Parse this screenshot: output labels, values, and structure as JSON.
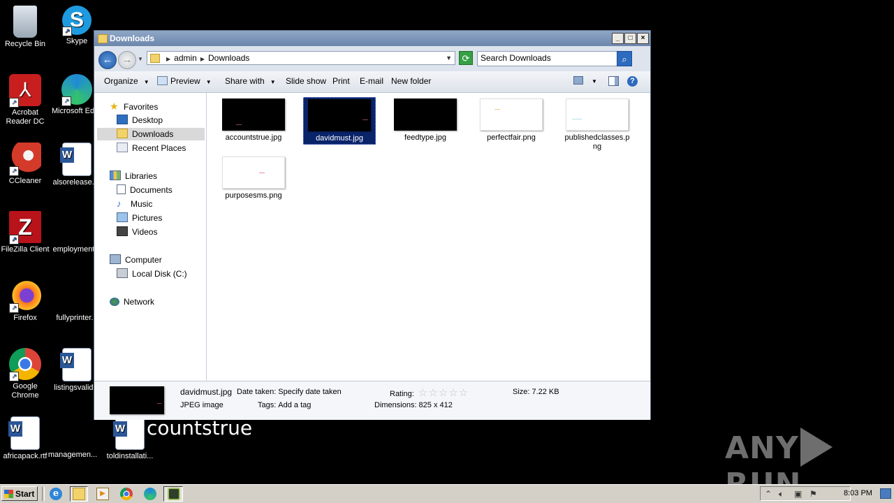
{
  "desktop": {
    "icons": [
      {
        "label": "Recycle Bin"
      },
      {
        "label": "Skype"
      },
      {
        "label": "Acrobat Reader DC"
      },
      {
        "label": "Microsoft Edge"
      },
      {
        "label": "CCleaner"
      },
      {
        "label": "alsorelease.rtf"
      },
      {
        "label": "FileZilla Client"
      },
      {
        "label": "employment..."
      },
      {
        "label": "Firefox"
      },
      {
        "label": "fullyprinter..."
      },
      {
        "label": "Google Chrome"
      },
      {
        "label": "listingsvalid..."
      },
      {
        "label": "africapack.rtf"
      },
      {
        "label": "managemen..."
      },
      {
        "label": "toldinstallati..."
      }
    ],
    "drag_text": "countstrue",
    "watermark": "ANY RUN"
  },
  "window": {
    "title": "Downloads",
    "controls": {
      "minimize": "_",
      "maximize": "□",
      "close": "×"
    },
    "address": {
      "crumbs": [
        "admin",
        "Downloads"
      ]
    },
    "search": {
      "placeholder": "Search Downloads"
    },
    "toolbar": {
      "organize": "Organize",
      "preview": "Preview",
      "share_with": "Share with",
      "slide_show": "Slide show",
      "print": "Print",
      "email": "E-mail",
      "new_folder": "New folder",
      "help": "?"
    },
    "nav": {
      "favorites": "Favorites",
      "desktop": "Desktop",
      "downloads": "Downloads",
      "recent_places": "Recent Places",
      "libraries": "Libraries",
      "documents": "Documents",
      "music": "Music",
      "pictures": "Pictures",
      "videos": "Videos",
      "computer": "Computer",
      "local_disk": "Local Disk (C:)",
      "network": "Network"
    },
    "files": [
      {
        "name": "accountstrue.jpg",
        "thumb": "dark",
        "accent": "#8a3a6a"
      },
      {
        "name": "davidmust.jpg",
        "thumb": "dark",
        "accent": "#8a3a6a",
        "selected": true
      },
      {
        "name": "feedtype.jpg",
        "thumb": "dark",
        "accent": "#000000"
      },
      {
        "name": "perfectfair.png",
        "thumb": "light",
        "accent": "#f0c68a"
      },
      {
        "name": "publishedclasses.png",
        "thumb": "light",
        "accent": "#b5dfe8"
      },
      {
        "name": "purposesms.png",
        "thumb": "light",
        "accent": "#f08aa8"
      }
    ],
    "details": {
      "filename": "davidmust.jpg",
      "filetype": "JPEG image",
      "date_taken_label": "Date taken:",
      "date_taken_value": "Specify date taken",
      "tags_label": "Tags:",
      "tags_value": "Add a tag",
      "rating_label": "Rating:",
      "rating_stars": "☆☆☆☆☆",
      "dimensions_label": "Dimensions:",
      "dimensions_value": "825 x 412",
      "size_label": "Size:",
      "size_value": "7.22 KB"
    }
  },
  "taskbar": {
    "start": "Start",
    "clock": "8:03 PM"
  }
}
